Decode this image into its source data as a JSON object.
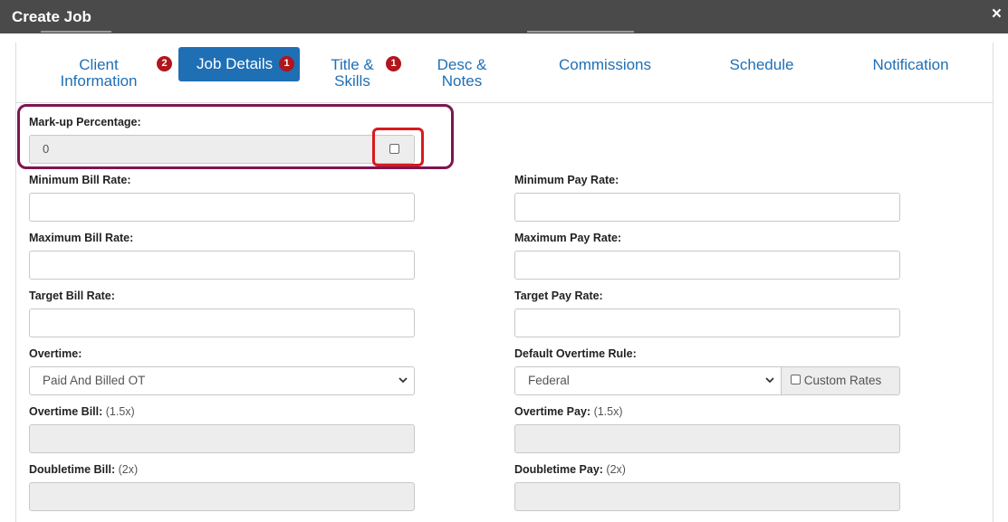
{
  "window": {
    "title": "Create Job",
    "close_glyph": "×"
  },
  "tabs": [
    {
      "line1": "Client",
      "line2": "Information",
      "badge": "2"
    },
    {
      "line1": "Job Details",
      "line2": "",
      "badge": "1"
    },
    {
      "line1": "Title &",
      "line2": "Skills",
      "badge": "1"
    },
    {
      "line1": "Desc &",
      "line2": "Notes",
      "badge": ""
    },
    {
      "line1": "Commissions",
      "line2": "",
      "badge": ""
    },
    {
      "line1": "Schedule",
      "line2": "",
      "badge": ""
    },
    {
      "line1": "Notification",
      "line2": "",
      "badge": ""
    }
  ],
  "markup": {
    "label": "Mark-up Percentage:",
    "value": "0"
  },
  "fields": {
    "min_bill": {
      "label": "Minimum Bill Rate:",
      "value": ""
    },
    "min_pay": {
      "label": "Minimum Pay Rate:",
      "value": ""
    },
    "max_bill": {
      "label": "Maximum Bill Rate:",
      "value": ""
    },
    "max_pay": {
      "label": "Maximum Pay Rate:",
      "value": ""
    },
    "target_bill": {
      "label": "Target Bill Rate:",
      "value": ""
    },
    "target_pay": {
      "label": "Target Pay Rate:",
      "value": ""
    },
    "overtime": {
      "label": "Overtime:",
      "value": "Paid And Billed OT"
    },
    "default_ot_rule": {
      "label": "Default Overtime Rule:",
      "value": "Federal"
    },
    "custom_rates": {
      "label": "Custom Rates"
    },
    "ot_bill": {
      "label": "Overtime Bill:",
      "hint": "(1.5x)",
      "value": ""
    },
    "ot_pay": {
      "label": "Overtime Pay:",
      "hint": "(1.5x)",
      "value": ""
    },
    "dt_bill": {
      "label": "Doubletime Bill:",
      "hint": "(2x)",
      "value": ""
    },
    "dt_pay": {
      "label": "Doubletime Pay:",
      "hint": "(2x)",
      "value": ""
    }
  },
  "colors": {
    "accent": "#1f6fb5",
    "badge": "#b0161b",
    "highlight_outer": "#7e1550",
    "highlight_inner": "#d81a1f"
  }
}
